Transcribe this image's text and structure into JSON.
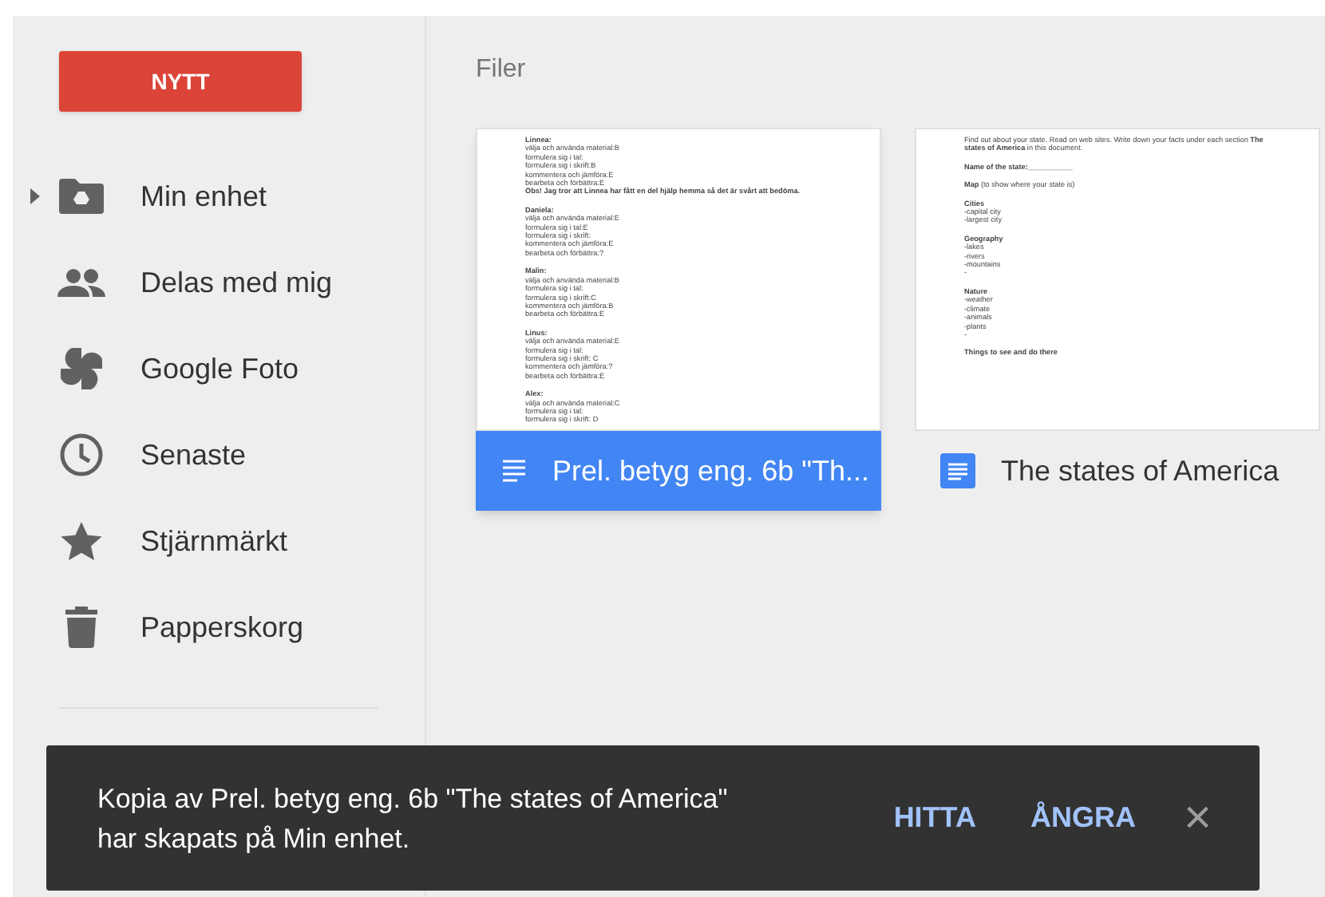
{
  "new_button": "NYTT",
  "sidebar": {
    "items": [
      {
        "label": "Min enhet",
        "kind": "drive",
        "expandable": true,
        "selected": false
      },
      {
        "label": "Delas med mig",
        "kind": "shared",
        "expandable": false,
        "selected": false
      },
      {
        "label": "Google Foto",
        "kind": "photos",
        "expandable": false,
        "selected": false
      },
      {
        "label": "Senaste",
        "kind": "recent",
        "expandable": false,
        "selected": false
      },
      {
        "label": "Stjärnmärkt",
        "kind": "starred",
        "expandable": false,
        "selected": false
      },
      {
        "label": "Papperskorg",
        "kind": "trash",
        "expandable": false,
        "selected": false
      }
    ]
  },
  "section_title": "Filer",
  "files": [
    {
      "name": "Prel. betyg eng. 6b \"Th...",
      "selected": true,
      "preview": [
        {
          "text": "Linnea:",
          "kind": "heading"
        },
        {
          "text": "välja och använda material:B",
          "kind": "line"
        },
        {
          "text": "formulera sig i tal:",
          "kind": "line"
        },
        {
          "text": "formulera sig i skrift:B",
          "kind": "line"
        },
        {
          "text": "kommentera och jämföra:E",
          "kind": "line"
        },
        {
          "text": "bearbeta och förbättra:E",
          "kind": "line"
        },
        {
          "text": "Obs! Jag tror att Linnea har fått en del hjälp hemma så det är svårt att bedöma.",
          "kind": "note"
        },
        {
          "text": "Daniela:",
          "kind": "heading"
        },
        {
          "text": "välja och använda material:E",
          "kind": "line"
        },
        {
          "text": "formulera sig i tal:E",
          "kind": "line"
        },
        {
          "text": "formulera sig i skrift:",
          "kind": "line"
        },
        {
          "text": "kommentera och jämföra:E",
          "kind": "line"
        },
        {
          "text": "bearbeta och förbättra:?",
          "kind": "line"
        },
        {
          "text": "Malin:",
          "kind": "heading"
        },
        {
          "text": "välja och använda material:B",
          "kind": "line"
        },
        {
          "text": "formulera sig i tal:",
          "kind": "line"
        },
        {
          "text": "formulera sig i skrift:C",
          "kind": "line"
        },
        {
          "text": "kommentera och jämföra:B",
          "kind": "line"
        },
        {
          "text": "bearbeta och förbättra:E",
          "kind": "line"
        },
        {
          "text": "Linus:",
          "kind": "heading"
        },
        {
          "text": "välja och använda material:E",
          "kind": "line"
        },
        {
          "text": "formulera sig i tal:",
          "kind": "line"
        },
        {
          "text": "formulera sig i skrift: C",
          "kind": "line"
        },
        {
          "text": "kommentera och jämföra:?",
          "kind": "line"
        },
        {
          "text": "bearbeta och förbättra:E",
          "kind": "line"
        },
        {
          "text": "Alex:",
          "kind": "heading"
        },
        {
          "text": "välja och använda material:C",
          "kind": "line"
        },
        {
          "text": "formulera sig i tal:",
          "kind": "line"
        },
        {
          "text": "formulera sig i skrift: D",
          "kind": "line"
        }
      ]
    },
    {
      "name": "The states of America",
      "selected": false,
      "preview": [
        {
          "text": "Find out about your state. Read on web sites. Write down your facts under each section  **The states of America** in this document.",
          "kind": "line"
        },
        {
          "text": "Name of the state:___________",
          "kind": "heading"
        },
        {
          "text": "**Map** (to show where your state is)",
          "kind": "section"
        },
        {
          "text": "Cities",
          "kind": "heading"
        },
        {
          "text": "-capital city",
          "kind": "line"
        },
        {
          "text": "-largest city",
          "kind": "line"
        },
        {
          "text": "Geography",
          "kind": "heading"
        },
        {
          "text": "-lakes",
          "kind": "line"
        },
        {
          "text": "-rivers",
          "kind": "line"
        },
        {
          "text": "-mountains",
          "kind": "line"
        },
        {
          "text": "-",
          "kind": "line"
        },
        {
          "text": "Nature",
          "kind": "heading"
        },
        {
          "text": "-weather",
          "kind": "line"
        },
        {
          "text": "-climate",
          "kind": "line"
        },
        {
          "text": "-animals",
          "kind": "line"
        },
        {
          "text": "-plants",
          "kind": "line"
        },
        {
          "text": "-",
          "kind": "line"
        },
        {
          "text": "Things to see and do there",
          "kind": "heading"
        }
      ]
    }
  ],
  "snackbar": {
    "message": "Kopia av Prel. betyg eng. 6b \"The states of America\" har skapats på Min enhet.",
    "actions": [
      "HITTA",
      "ÅNGRA"
    ],
    "close": "×"
  }
}
